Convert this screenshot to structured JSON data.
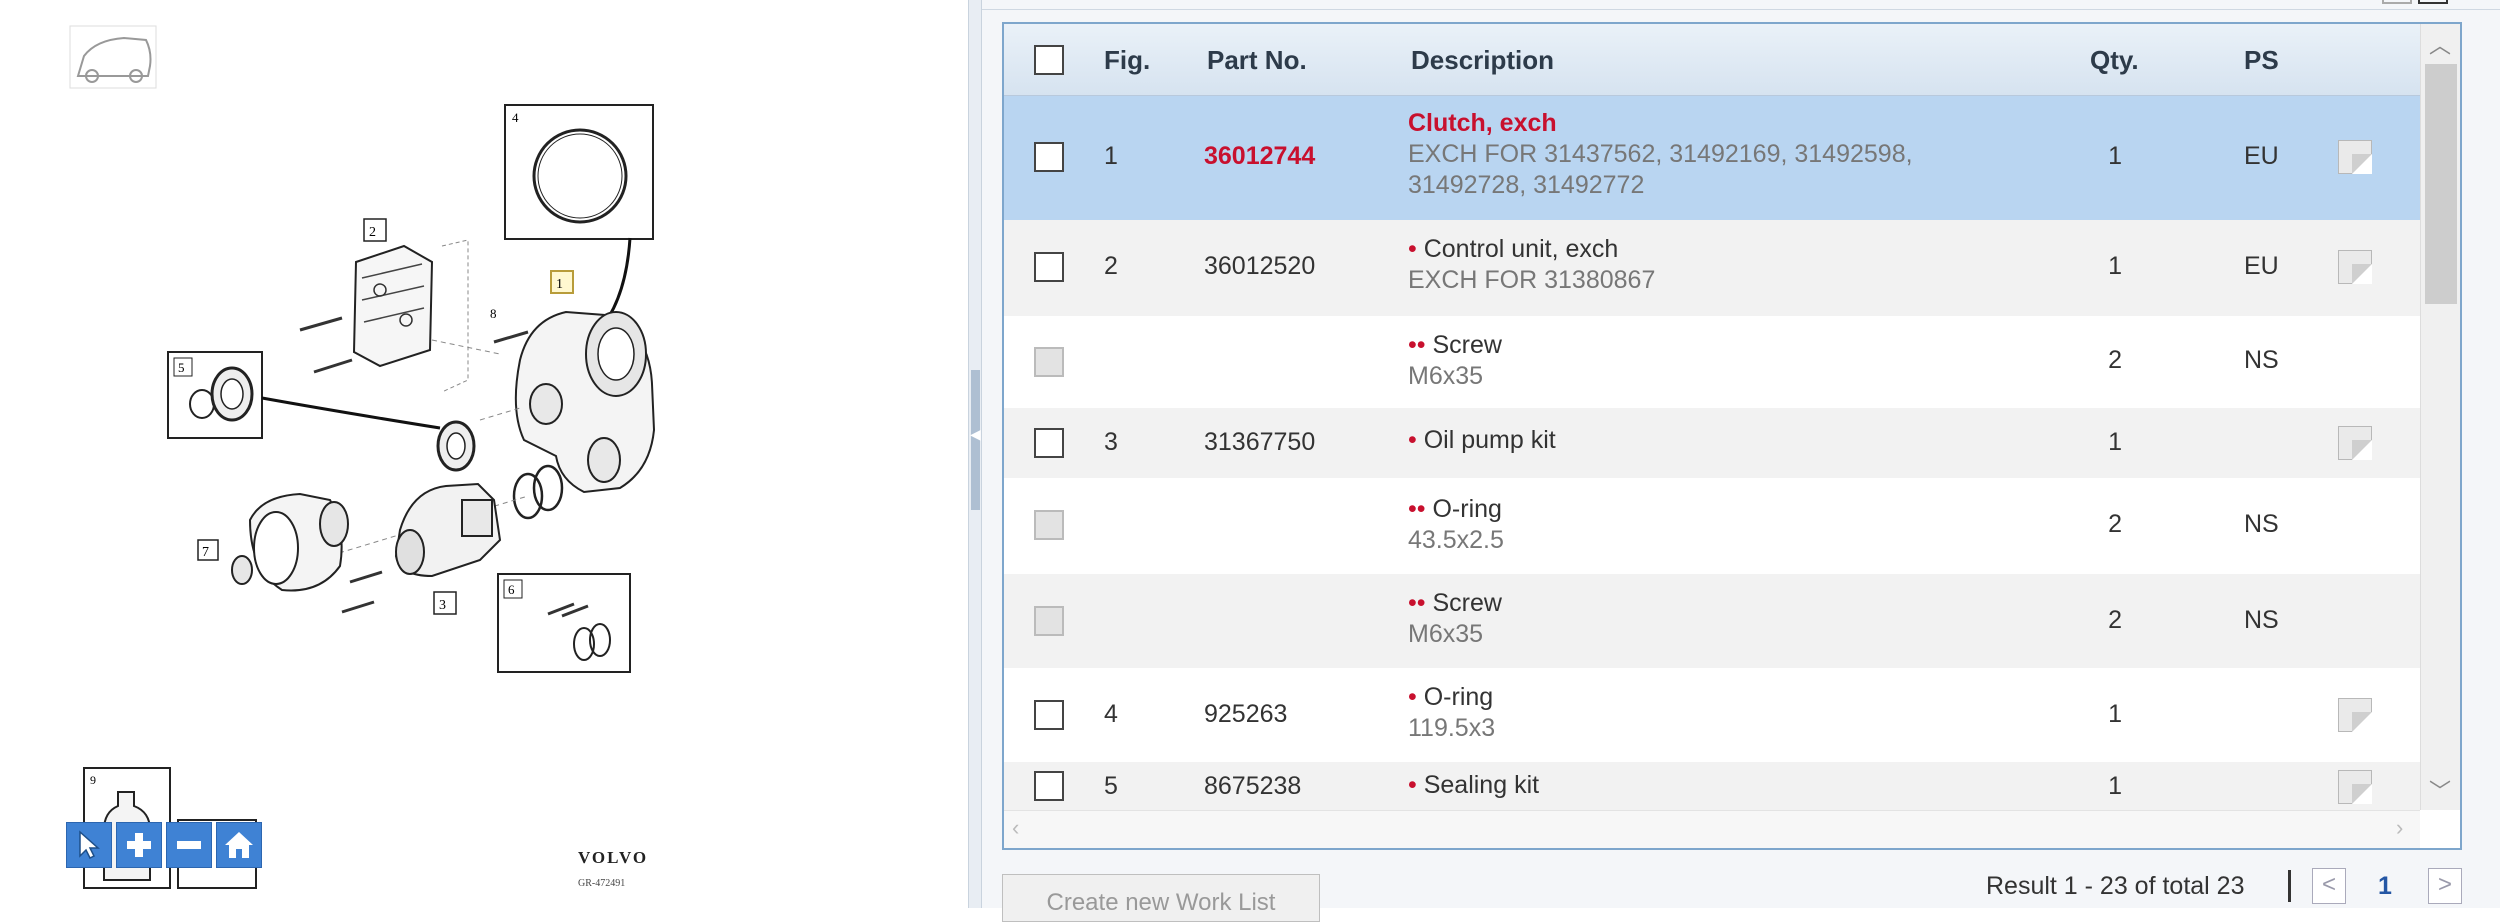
{
  "diagram": {
    "callouts": [
      "1",
      "2",
      "3",
      "4",
      "5",
      "6",
      "7",
      "8",
      "9"
    ],
    "brand": "VOLVO",
    "ref_code": "GR-472491"
  },
  "grid": {
    "headers": {
      "fig": "Fig.",
      "part_no": "Part No.",
      "description": "Description",
      "qty": "Qty.",
      "ps": "PS"
    },
    "rows": [
      {
        "fig": "1",
        "part_no": "36012744",
        "bullet": "",
        "title": "Clutch, exch",
        "sub": [
          "EXCH FOR 31437562, 31492169, 31492598,",
          "31492728, 31492772"
        ],
        "qty": "1",
        "ps": "EU"
      },
      {
        "fig": "2",
        "part_no": "36012520",
        "bullet": "•",
        "title": "Control unit, exch",
        "sub": [
          "EXCH FOR 31380867"
        ],
        "qty": "1",
        "ps": "EU"
      },
      {
        "fig": "",
        "part_no": "",
        "bullet": "••",
        "title": "Screw",
        "sub": [
          "M6x35"
        ],
        "qty": "2",
        "ps": "NS"
      },
      {
        "fig": "3",
        "part_no": "31367750",
        "bullet": "•",
        "title": "Oil pump kit",
        "sub": [],
        "qty": "1",
        "ps": ""
      },
      {
        "fig": "",
        "part_no": "",
        "bullet": "••",
        "title": "O-ring",
        "sub": [
          "43.5x2.5"
        ],
        "qty": "2",
        "ps": "NS"
      },
      {
        "fig": "",
        "part_no": "",
        "bullet": "••",
        "title": "Screw",
        "sub": [
          "M6x35"
        ],
        "qty": "2",
        "ps": "NS"
      },
      {
        "fig": "4",
        "part_no": "925263",
        "bullet": "•",
        "title": "O-ring",
        "sub": [
          "119.5x3"
        ],
        "qty": "1",
        "ps": ""
      },
      {
        "fig": "5",
        "part_no": "8675238",
        "bullet": "•",
        "title": "Sealing kit",
        "sub": [],
        "qty": "1",
        "ps": ""
      }
    ]
  },
  "footer": {
    "create_button": "Create new Work List",
    "result_text": "Result 1 - 23 of total 23",
    "page": "1",
    "prev": "<",
    "next": ">"
  },
  "icons": {
    "zoom_cursor": "cursor-icon",
    "zoom_in": "plus-icon",
    "zoom_out": "minus-icon",
    "home": "home-icon",
    "note": "note-icon"
  },
  "colors": {
    "accent_red": "#c8102e",
    "selected_row": "#b9d5f1",
    "zoom_blue": "#3f82d4",
    "grid_border": "#7ea6cc"
  }
}
